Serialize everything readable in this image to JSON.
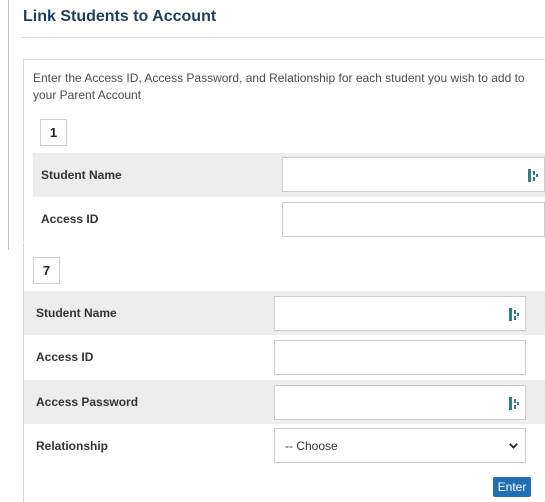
{
  "page": {
    "title": "Link Students to Account",
    "intro": "Enter the Access ID, Access Password, and Relationship for each student you wish to add to your Parent Account"
  },
  "student1": {
    "number": "1",
    "student_name_label": "Student Name",
    "access_id_label": "Access ID"
  },
  "student7": {
    "number": "7",
    "student_name_label": "Student Name",
    "access_id_label": "Access ID",
    "access_password_label": "Access Password",
    "relationship_label": "Relationship",
    "relationship_selected": "-- Choose"
  },
  "actions": {
    "enter_label": "Enter"
  },
  "icons": {
    "field_icon": "password-manager-icon",
    "select_arrow": "chevron-down-icon"
  },
  "colors": {
    "title": "#1f3f60",
    "button": "#1f6fb2",
    "shaded_row": "#ededed",
    "icon": "#2e7d86"
  }
}
